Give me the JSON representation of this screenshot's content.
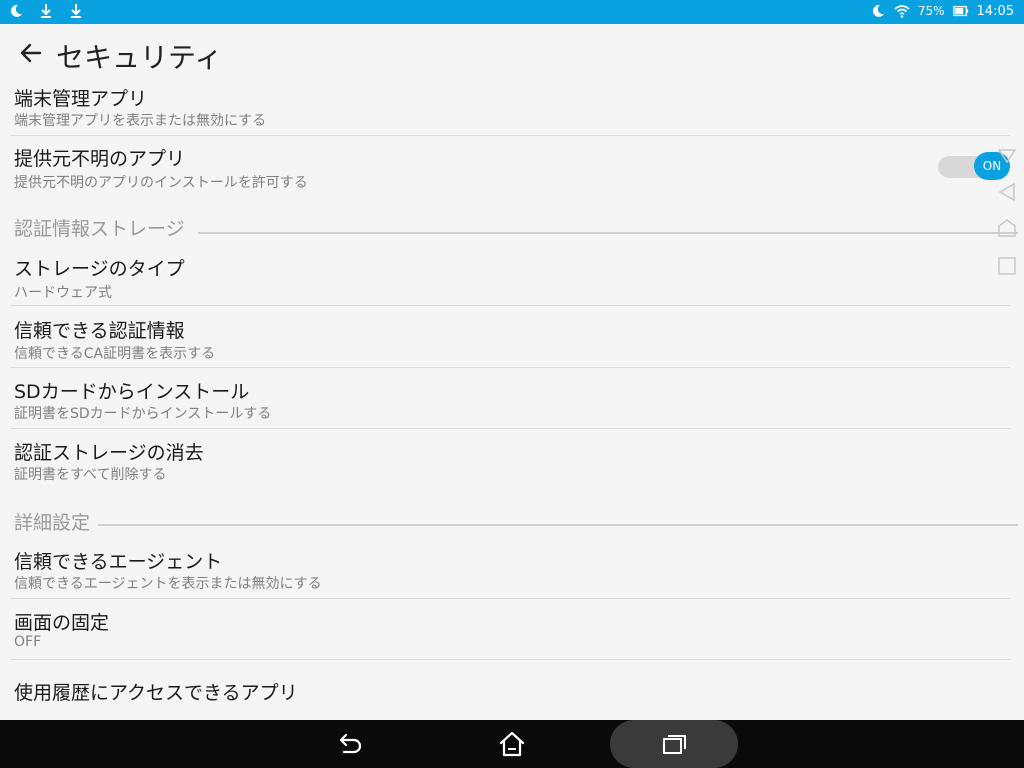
{
  "status_bar": {
    "left_icons": [
      "moon-icon",
      "download-icon",
      "download-icon"
    ],
    "right_icons": [
      "moon-icon",
      "wifi-icon"
    ],
    "battery": "75%",
    "clock": "14:05",
    "color": "#0aa1e0"
  },
  "header": {
    "title": "セキュリティ",
    "back_icon": "back-arrow-icon"
  },
  "items": {
    "device_admin": {
      "title": "端末管理アプリ",
      "subtitle": "端末管理アプリを表示または無効にする"
    },
    "unknown_sources": {
      "title": "提供元不明のアプリ",
      "subtitle": "提供元不明のアプリのインストールを許可する",
      "toggle": "ON"
    },
    "storage_type": {
      "title": "ストレージのタイプ",
      "subtitle": "ハードウェア式"
    },
    "trusted_creds": {
      "title": "信頼できる認証情報",
      "subtitle": "信頼できるCA証明書を表示する"
    },
    "install_sd": {
      "title": "SDカードからインストール",
      "subtitle": "証明書をSDカードからインストールする"
    },
    "clear_creds": {
      "title": "認証ストレージの消去",
      "subtitle": "証明書をすべて削除する"
    },
    "trust_agents": {
      "title": "信頼できるエージェント",
      "subtitle": "信頼できるエージェントを表示または無効にする"
    },
    "screen_pinning": {
      "title": "画面の固定",
      "subtitle": "OFF"
    },
    "usage_access": {
      "title": "使用履歴にアクセスできるアプリ"
    }
  },
  "sections": {
    "credential_storage": "認証情報ストレージ",
    "advanced": "詳細設定"
  },
  "navigation": {
    "back": "back-icon",
    "home": "home-icon",
    "recents": "recents-icon"
  },
  "accent_color": "#0aa1e0"
}
